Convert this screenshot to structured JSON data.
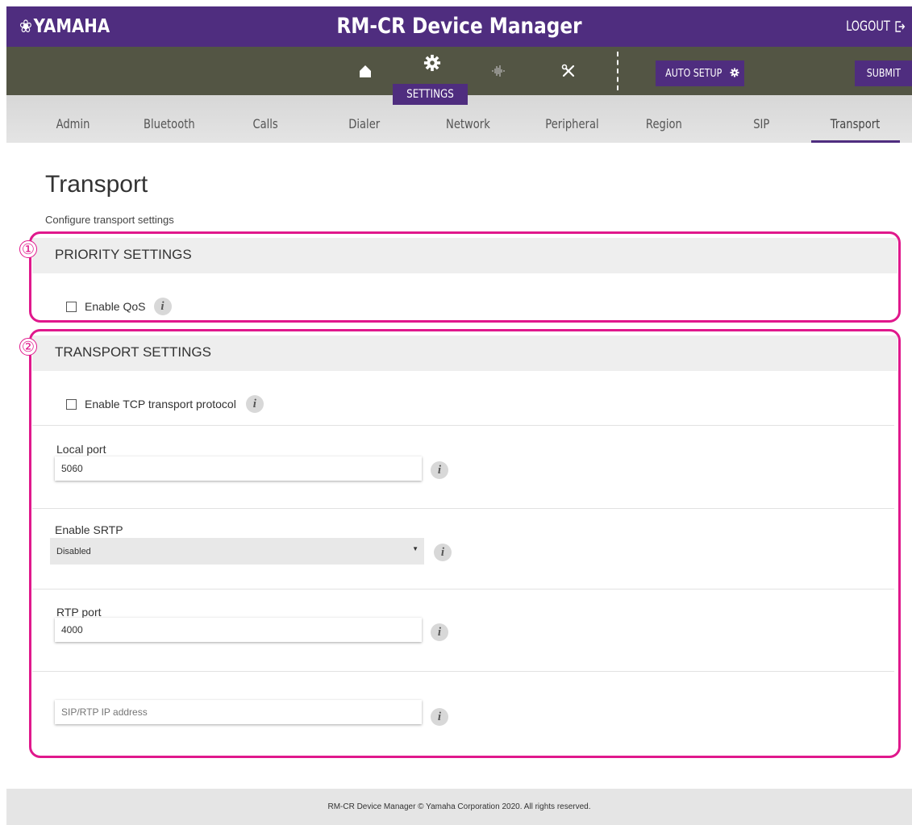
{
  "header": {
    "brand": "YAMAHA",
    "brand_mark": "❀",
    "title": "RM-CR Device Manager",
    "logout_label": "LOGOUT"
  },
  "toolbar": {
    "icons": [
      "home-icon",
      "gear-icon",
      "audio-waveform-icon",
      "tools-icon",
      "gear-icon"
    ],
    "active_label": "SETTINGS",
    "auto_setup_label": "AUTO SETUP",
    "submit_label": "SUBMIT"
  },
  "tabs": [
    {
      "label": "Admin"
    },
    {
      "label": "Bluetooth"
    },
    {
      "label": "Calls"
    },
    {
      "label": "Dialer"
    },
    {
      "label": "Network"
    },
    {
      "label": "Peripheral"
    },
    {
      "label": "Region"
    },
    {
      "label": "SIP"
    },
    {
      "label": "Transport",
      "active": true
    }
  ],
  "page": {
    "title": "Transport",
    "subtitle": "Configure transport settings"
  },
  "priority": {
    "callout": "①",
    "heading": "PRIORITY SETTINGS",
    "qos_label": "Enable QoS",
    "qos_checked": false
  },
  "transport": {
    "callout": "②",
    "heading": "TRANSPORT SETTINGS",
    "tcp_label": "Enable TCP transport protocol",
    "tcp_checked": false,
    "local_port_label": "Local port",
    "local_port_value": "5060",
    "srtp_label": "Enable SRTP",
    "srtp_value": "Disabled",
    "rtp_port_label": "RTP port",
    "rtp_port_value": "4000",
    "sip_rtp_ip_placeholder": "SIP/RTP IP address",
    "sip_rtp_ip_value": ""
  },
  "info_glyph": "i",
  "colors": {
    "brand_purple": "#4f2d7f",
    "toolbar": "#535544",
    "callout": "#e0188c"
  },
  "footer": {
    "text": "RM-CR Device Manager © Yamaha Corporation 2020. All rights reserved."
  }
}
